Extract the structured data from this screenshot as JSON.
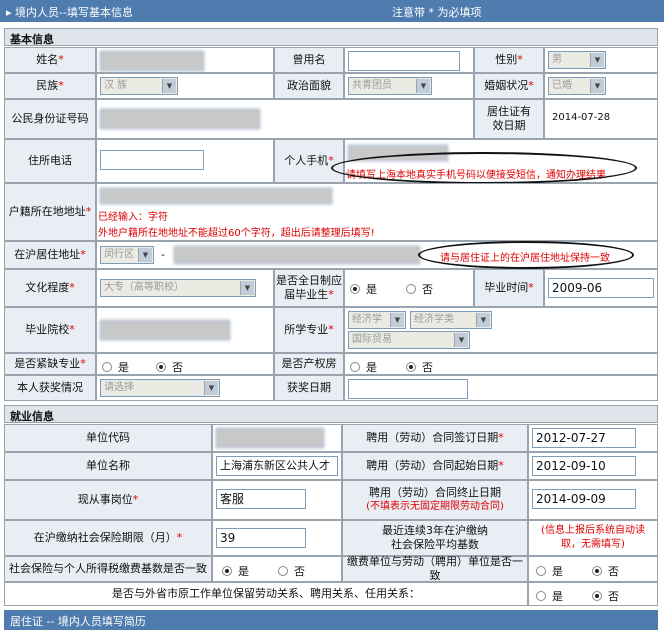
{
  "title_bar": {
    "title": "▸ 境内人员--填写基本信息",
    "note": "注意带 * 为必填项"
  },
  "basic": {
    "section_title": "基本信息",
    "name_label": "姓名",
    "former_name_label": "曾用名",
    "gender_label": "性别",
    "gender_value": "男",
    "ethnicity_label": "民族",
    "ethnicity_value": "汉 族",
    "politics_label": "政治面貌",
    "politics_value": "共青团员",
    "marital_label": "婚姻状况",
    "marital_value": "已婚",
    "id_label": "公民身份证号码",
    "permit_expiry_label": "居住证有效日期",
    "permit_expiry_value": "2014-07-28",
    "home_phone_label": "住所电话",
    "mobile_label": "个人手机",
    "mobile_hint": "请填写上海本地真实手机号码以便接受短信，通知办理结果",
    "hukou_label": "户籍所在地地址",
    "hukou_hint1": "已经输入：字符",
    "hukou_hint2": "外地户籍所在地地址不能超过60个字符，超出后请整理后填写!",
    "sh_address_label": "在沪居住地址",
    "district_value": "闵行区",
    "dash": "-",
    "address_hint": "请与居住证上的在沪居住地址保持一致",
    "education_label": "文化程度",
    "education_value": "大专（高等职校）",
    "fulltime_label": "是否全日制应届毕业生",
    "yes": "是",
    "no": "否",
    "grad_time_label": "毕业时间",
    "grad_time_value": "2009-06",
    "school_label": "毕业院校",
    "major_label": "所学专业",
    "major_values": [
      "经济学",
      "经济学类",
      "国际贸易"
    ],
    "shortage_label": "是否紧缺专业",
    "property_label": "是否产权房",
    "award_label": "本人获奖情况",
    "award_value": "请选择",
    "award_date_label": "获奖日期"
  },
  "employment": {
    "section_title": "就业信息",
    "unit_code_label": "单位代码",
    "contract_sign_label": "聘用（劳动）合同签订日期",
    "contract_sign_value": "2012-07-27",
    "unit_name_label": "单位名称",
    "unit_name_value": "上海浦东新区公共人才",
    "contract_start_label": "聘用（劳动）合同起始日期",
    "contract_start_value": "2012-09-10",
    "position_label": "现从事岗位",
    "position_value": "客服",
    "contract_end_label": "聘用（劳动）合同终止日期",
    "contract_end_note": "(不填表示无固定期限劳动合同)",
    "contract_end_value": "2014-09-09",
    "insurance_months_label": "在沪缴纳社会保险期限（月）",
    "insurance_months_value": "39",
    "avg_base_label": "最近连续3年在沪缴纳社会保险平均基数",
    "avg_base_hint": "(信息上报后系统自动读取，无需填写)",
    "tax_consistent_label": "社会保险与个人所得税缴费基数是否一致",
    "payer_consistent_label": "缴费单位与劳动（聘用）单位是否一致",
    "prior_relation_label": "是否与外省市原工作单位保留劳动关系、聘用关系、任用关系：",
    "yes": "是",
    "no": "否"
  },
  "footer": {
    "title": "居住证 -- 境内人员填写简历"
  }
}
